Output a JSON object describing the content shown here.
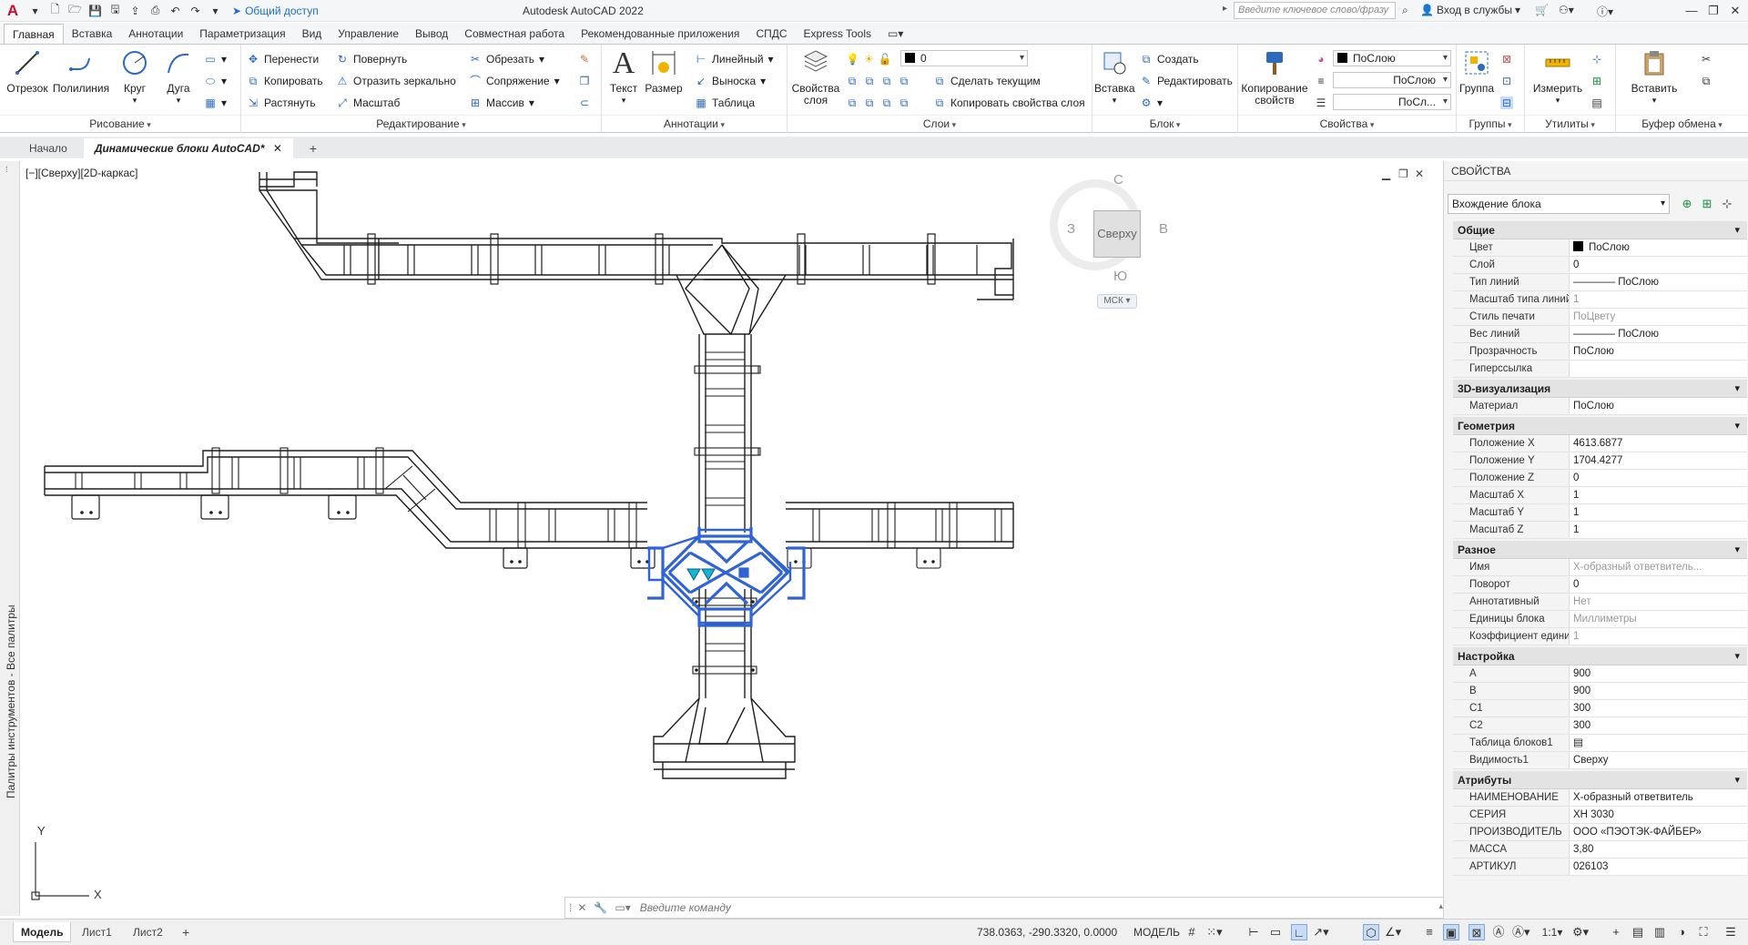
{
  "titlebar": {
    "share_label": "Общий доступ",
    "title": "Autodesk AutoCAD 2022",
    "search_placeholder": "Введите ключевое слово/фразу",
    "signin_label": "Вход в службы"
  },
  "ribbon_tabs": [
    "Главная",
    "Вставка",
    "Аннотации",
    "Параметризация",
    "Вид",
    "Управление",
    "Вывод",
    "Совместная работа",
    "Рекомендованные приложения",
    "СПДС",
    "Express Tools"
  ],
  "ribbon": {
    "draw": {
      "title": "Рисование",
      "line": "Отрезок",
      "polyline": "Полилиния",
      "circle": "Круг",
      "arc": "Дуга"
    },
    "modify": {
      "title": "Редактирование",
      "move": "Перенести",
      "copy": "Копировать",
      "stretch": "Растянуть",
      "rotate": "Повернуть",
      "mirror": "Отразить зеркально",
      "scale": "Масштаб",
      "trim": "Обрезать",
      "fillet": "Сопряжение",
      "array": "Массив"
    },
    "annotation": {
      "title": "Аннотации",
      "text": "Текст",
      "dimension": "Размер",
      "linear": "Линейный",
      "leader": "Выноска",
      "table": "Таблица"
    },
    "layers": {
      "title": "Слои",
      "layer_props": "Свойства слоя",
      "layer_value": "0",
      "make_current": "Сделать текущим",
      "match_layer": "Копировать свойства слоя"
    },
    "block": {
      "title": "Блок",
      "insert": "Вставка",
      "create": "Создать",
      "edit": "Редактировать"
    },
    "properties": {
      "title": "Свойства",
      "match": "Копирование свойств",
      "color": "ПоСлою",
      "linetype": "ПоСлою",
      "lineweight": "ПоСл..."
    },
    "groups": {
      "title": "Группы",
      "group": "Группа"
    },
    "utilities": {
      "title": "Утилиты",
      "measure": "Измерить"
    },
    "clipboard": {
      "title": "Буфер обмена",
      "paste": "Вставить"
    }
  },
  "file_tabs": [
    "Начало",
    "Динамические блоки AutoCAD*"
  ],
  "palette_strip_label": "Палитры инструментов - Все палитры",
  "viewport": {
    "label": "[−][Сверху][2D-каркас]",
    "viewcube": {
      "north": "С",
      "south": "Ю",
      "west": "З",
      "east": "В",
      "face": "Сверху",
      "ucs": "МСК"
    },
    "axis_y": "Y",
    "axis_x": "X"
  },
  "cmdline": {
    "placeholder": "Введите команду"
  },
  "properties_palette": {
    "title": "СВОЙСТВА",
    "selection": "Вхождение блока",
    "sections": [
      {
        "name": "Общие",
        "rows": [
          {
            "k": "Цвет",
            "v": "ПоСлою",
            "swatch": true
          },
          {
            "k": "Слой",
            "v": "0"
          },
          {
            "k": "Тип линий",
            "v": "———— ПоСлою"
          },
          {
            "k": "Масштаб типа линий",
            "v": "1",
            "dim": true
          },
          {
            "k": "Стиль печати",
            "v": "ПоЦвету",
            "dim": true
          },
          {
            "k": "Вес линий",
            "v": "———— ПоСлою"
          },
          {
            "k": "Прозрачность",
            "v": "ПоСлою"
          },
          {
            "k": "Гиперссылка",
            "v": ""
          }
        ]
      },
      {
        "name": "3D-визуализация",
        "rows": [
          {
            "k": "Материал",
            "v": "ПоСлою"
          }
        ]
      },
      {
        "name": "Геометрия",
        "rows": [
          {
            "k": "Положение X",
            "v": "4613.6877"
          },
          {
            "k": "Положение Y",
            "v": "1704.4277"
          },
          {
            "k": "Положение Z",
            "v": "0"
          },
          {
            "k": "Масштаб X",
            "v": "1"
          },
          {
            "k": "Масштаб Y",
            "v": "1"
          },
          {
            "k": "Масштаб Z",
            "v": "1"
          }
        ]
      },
      {
        "name": "Разное",
        "rows": [
          {
            "k": "Имя",
            "v": "Х-образный ответвитель...",
            "dim": true
          },
          {
            "k": "Поворот",
            "v": "0"
          },
          {
            "k": "Аннотативный",
            "v": "Нет",
            "dim": true
          },
          {
            "k": "Единицы блока",
            "v": "Миллиметры",
            "dim": true
          },
          {
            "k": "Коэффициент единиц",
            "v": "1",
            "dim": true
          }
        ]
      },
      {
        "name": "Настройка",
        "rows": [
          {
            "k": "A",
            "v": "900"
          },
          {
            "k": "B",
            "v": "900"
          },
          {
            "k": "C1",
            "v": "300"
          },
          {
            "k": "C2",
            "v": "300"
          },
          {
            "k": "Таблица блоков1",
            "v": "▤"
          },
          {
            "k": "Видимость1",
            "v": "Сверху"
          }
        ]
      },
      {
        "name": "Атрибуты",
        "rows": [
          {
            "k": "НАИМЕНОВАНИЕ",
            "v": "Х-образный ответвитель"
          },
          {
            "k": "СЕРИЯ",
            "v": "ХН 3030"
          },
          {
            "k": "ПРОИЗВОДИТЕЛЬ",
            "v": "ООО «ПЭОТЭК-ФАЙБЕР»"
          },
          {
            "k": "МАССА",
            "v": "3,80"
          },
          {
            "k": "АРТИКУЛ",
            "v": "026103"
          }
        ]
      }
    ]
  },
  "statusbar": {
    "layout_tabs": [
      "Модель",
      "Лист1",
      "Лист2"
    ],
    "coords": "738.0363, -290.3320, 0.0000",
    "space": "МОДЕЛЬ",
    "scale": "1:1"
  },
  "colors": {
    "selection": "#2f63d6",
    "accent": "#1b6fd1",
    "grip": "#18b4d8"
  }
}
